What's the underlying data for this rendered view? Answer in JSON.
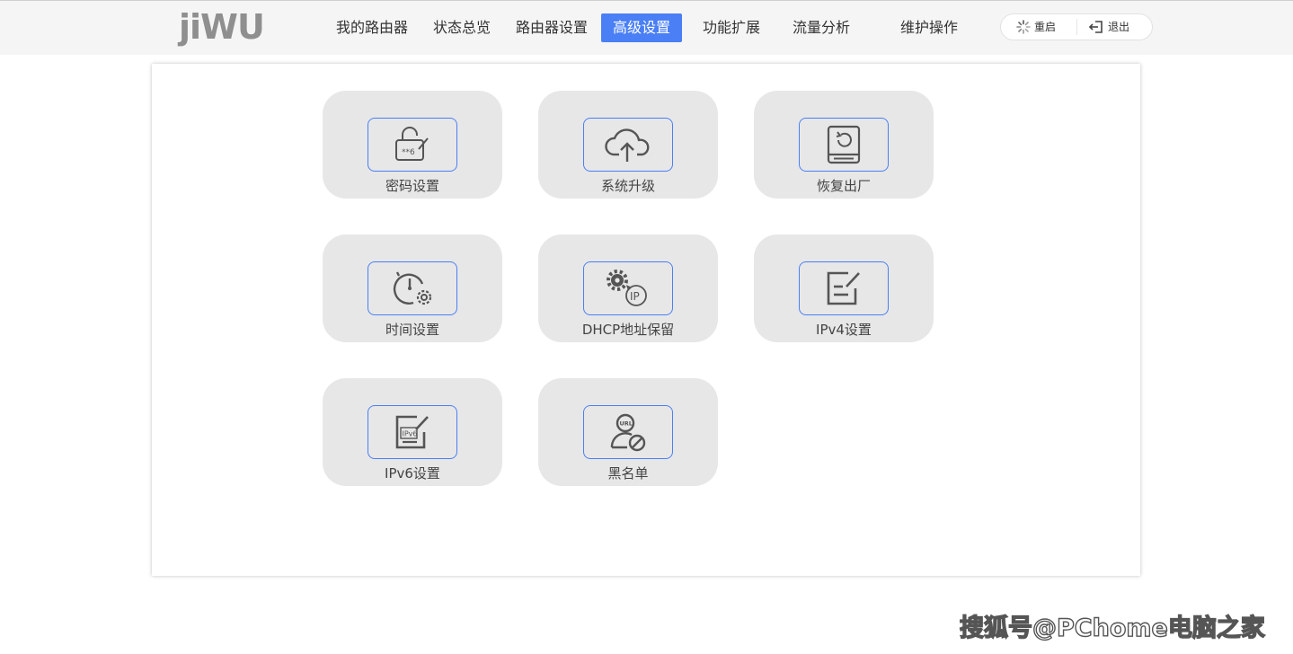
{
  "header": {
    "logo_text": "jiWU",
    "nav": [
      {
        "label": "我的路由器",
        "active": false
      },
      {
        "label": "状态总览",
        "active": false
      },
      {
        "label": "路由器设置",
        "active": false
      },
      {
        "label": "高级设置",
        "active": true
      },
      {
        "label": "功能扩展",
        "active": false
      },
      {
        "label": "流量分析",
        "active": false
      },
      {
        "label": "维护操作",
        "active": false
      }
    ],
    "actions": {
      "restart_label": "重启",
      "restart_icon": "spinner-icon",
      "logout_label": "退出",
      "logout_icon": "logout-icon"
    }
  },
  "tiles": [
    {
      "label": "密码设置",
      "icon": "lock-edit-icon"
    },
    {
      "label": "系统升级",
      "icon": "cloud-upload-icon"
    },
    {
      "label": "恢复出厂",
      "icon": "device-restore-icon"
    },
    {
      "label": "时间设置",
      "icon": "clock-gear-icon"
    },
    {
      "label": "DHCP地址保留",
      "icon": "gear-ip-icon"
    },
    {
      "label": "IPv4设置",
      "icon": "edit-note-icon"
    },
    {
      "label": "IPv6设置",
      "icon": "ipv6-edit-icon"
    },
    {
      "label": "黑名单",
      "icon": "user-url-block-icon"
    }
  ],
  "watermark": "搜狐号@PChome电脑之家",
  "colors": {
    "accent": "#4a7ff5",
    "tile_bg": "#e7e7e7",
    "icon_stroke": "#555555"
  }
}
